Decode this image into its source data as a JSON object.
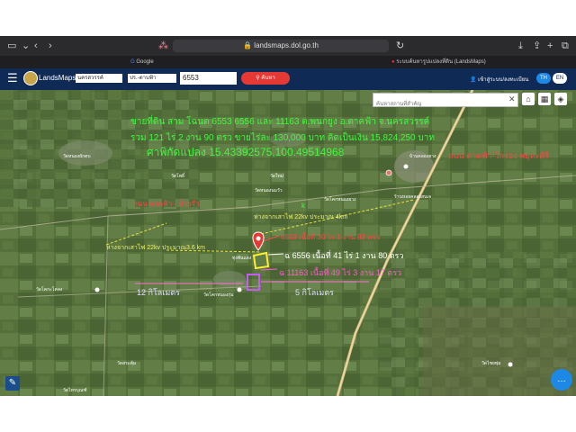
{
  "browser": {
    "url": "landsmaps.dol.go.th",
    "tabs": [
      "Google",
      "ระบบค้นหารูปแปลงที่ดิน (LandsMaps)"
    ]
  },
  "header": {
    "app_name": "LandsMaps",
    "province": "นครสวรรค์",
    "doc_type": "ปร.-ตาบฟ้า",
    "parcel_number": "6553",
    "search_label": "ค้นหา",
    "login_label": "เข้าสู่ระบบ/ลงทะเบียน",
    "lang_th": "TH",
    "lang_en": "EN"
  },
  "map": {
    "search_placeholder": "ค้นหาสถานที่สำคัญ",
    "annotations": {
      "sale_title": "ขายที่ดิน สาม โฉนด 6553 6556 และ 11163 ต.พนกยูง อ.ตาคฟ้า จ.นครสวรรค์",
      "sale_total": "รวม 121 ไร่ 2 งาน 90 ตรว ขายไร่ละ 130,000 บาท คิดเป็นเงิน 15,824,250 บาท",
      "coords": "ศาพิกัดแปลง 15.43392575,100.49514968",
      "road_right": "ถนน ตาคฟ้า-วิกรอง พยุหะคีรี",
      "road_left": "ถนน ตาคฟ้า - ห้วยรั่ว",
      "power_line_right": "ห่างจากเสาไฟ 22kv ประมาณ 4km",
      "power_line_left": "ห่างจากเสาไฟ 22kv ประมาณ3.6 km",
      "deed_6553": "6553 เนื้อที่ 30 ไร่ 1 งาน 93 ตรว",
      "deed_6556": "ฉ 6556 เนื้อที่ 41 ไร่ 1 งาน 80 ตรว",
      "deed_11163": "ฉ 11163 เนื้อที่ 49 ไร่ 3 งาน 17 ตรว",
      "dist_left": "12 กิโลเมตร",
      "dist_right": "5 กิโลเมตร",
      "letter_k": "k"
    },
    "place_labels": [
      "วัดหนองผักตบ",
      "วัดโพธิ์",
      "บ้านคลองยาง",
      "วัดหนองนมวัว",
      "วัดโคกหนองยาง",
      "ร้านหอยคลองสนเจ",
      "วัดใหม่",
      "วัดโคกะโคลง",
      "วัดโคกหนองกุ่ม",
      "ทุ่งพันแดง",
      "วัดไชยพุ่ม",
      "วัดสระคุ้ม",
      "วัดไทรบุณฑ์"
    ]
  }
}
